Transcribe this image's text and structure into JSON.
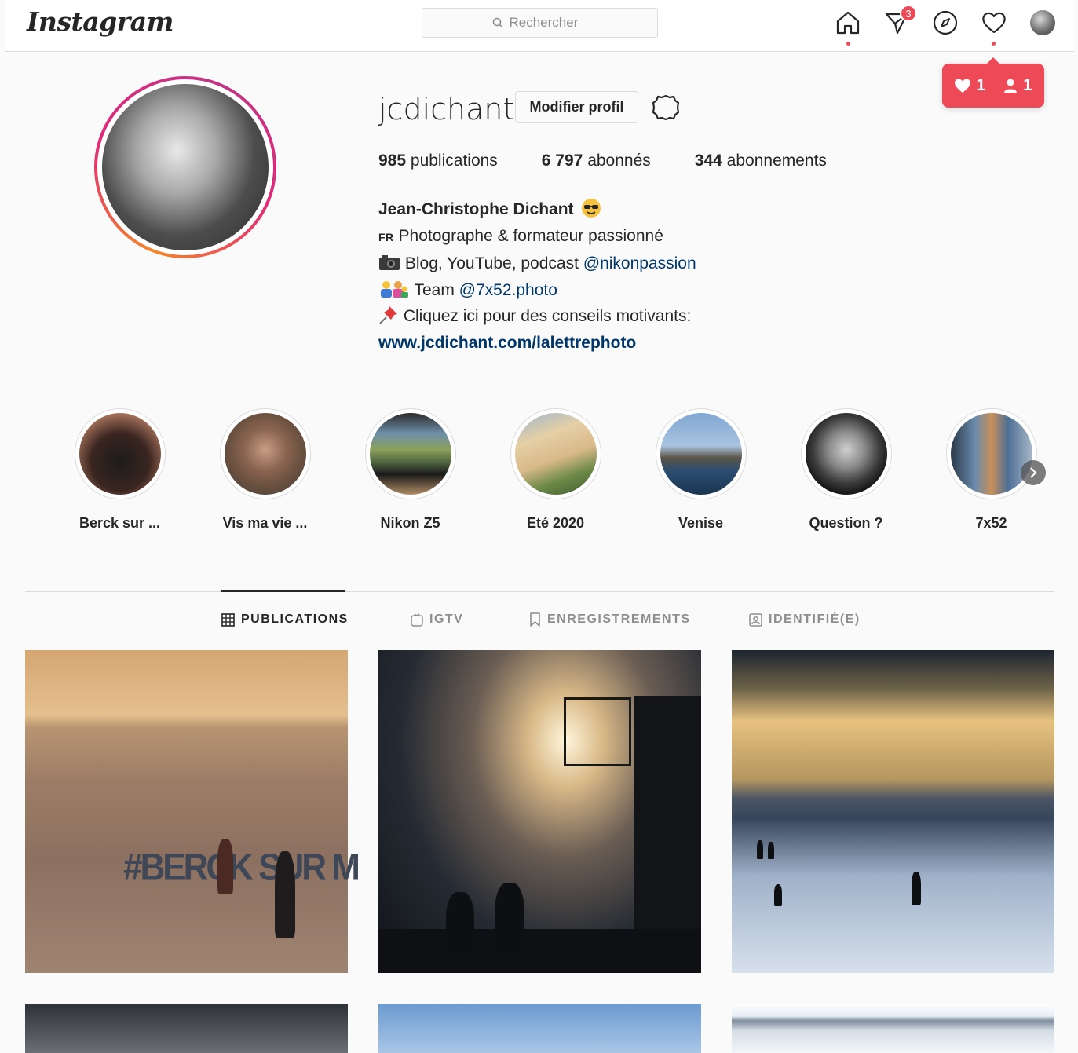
{
  "header": {
    "logo": "Instagram",
    "search_placeholder": "Rechercher",
    "direct_badge": "3"
  },
  "activity_popup": {
    "likes": "1",
    "followers": "1"
  },
  "profile": {
    "username": "jcdichant",
    "edit_label": "Modifier profil",
    "stats": {
      "posts_count": "985",
      "posts_label": "publications",
      "followers_count": "6 797",
      "followers_label": "abonnés",
      "following_count": "344",
      "following_label": "abonnements"
    },
    "bio": {
      "full_name": "Jean-Christophe Dichant",
      "line1_prefix": "FR",
      "line1": "Photographe & formateur passionné",
      "line2_text": "Blog, YouTube, podcast",
      "line2_link": "@nikonpassion",
      "line3_text": "Team",
      "line3_link": "@7x52.photo",
      "line4": "Cliquez ici pour des conseils motivants:",
      "url": "www.jcdichant.com/lalettrephoto"
    }
  },
  "highlights": [
    {
      "label": "Berck sur ..."
    },
    {
      "label": "Vis ma vie ..."
    },
    {
      "label": "Nikon Z5"
    },
    {
      "label": "Eté 2020"
    },
    {
      "label": "Venise"
    },
    {
      "label": "Question ?"
    },
    {
      "label": "7x52"
    }
  ],
  "tabs": [
    {
      "label": "PUBLICATIONS",
      "icon": "grid-icon",
      "active": true
    },
    {
      "label": "IGTV",
      "icon": "igtv-icon",
      "active": false
    },
    {
      "label": "ENREGISTREMENTS",
      "icon": "bookmark-icon",
      "active": false
    },
    {
      "label": "IDENTIFIÉ(E)",
      "icon": "tagged-icon",
      "active": false
    }
  ],
  "post_overlay_text": "#BERCK SUR M",
  "colors": {
    "accent_red": "#ed4956",
    "link_blue": "#00376b",
    "border": "#dbdbdb",
    "background": "#fafafa"
  }
}
